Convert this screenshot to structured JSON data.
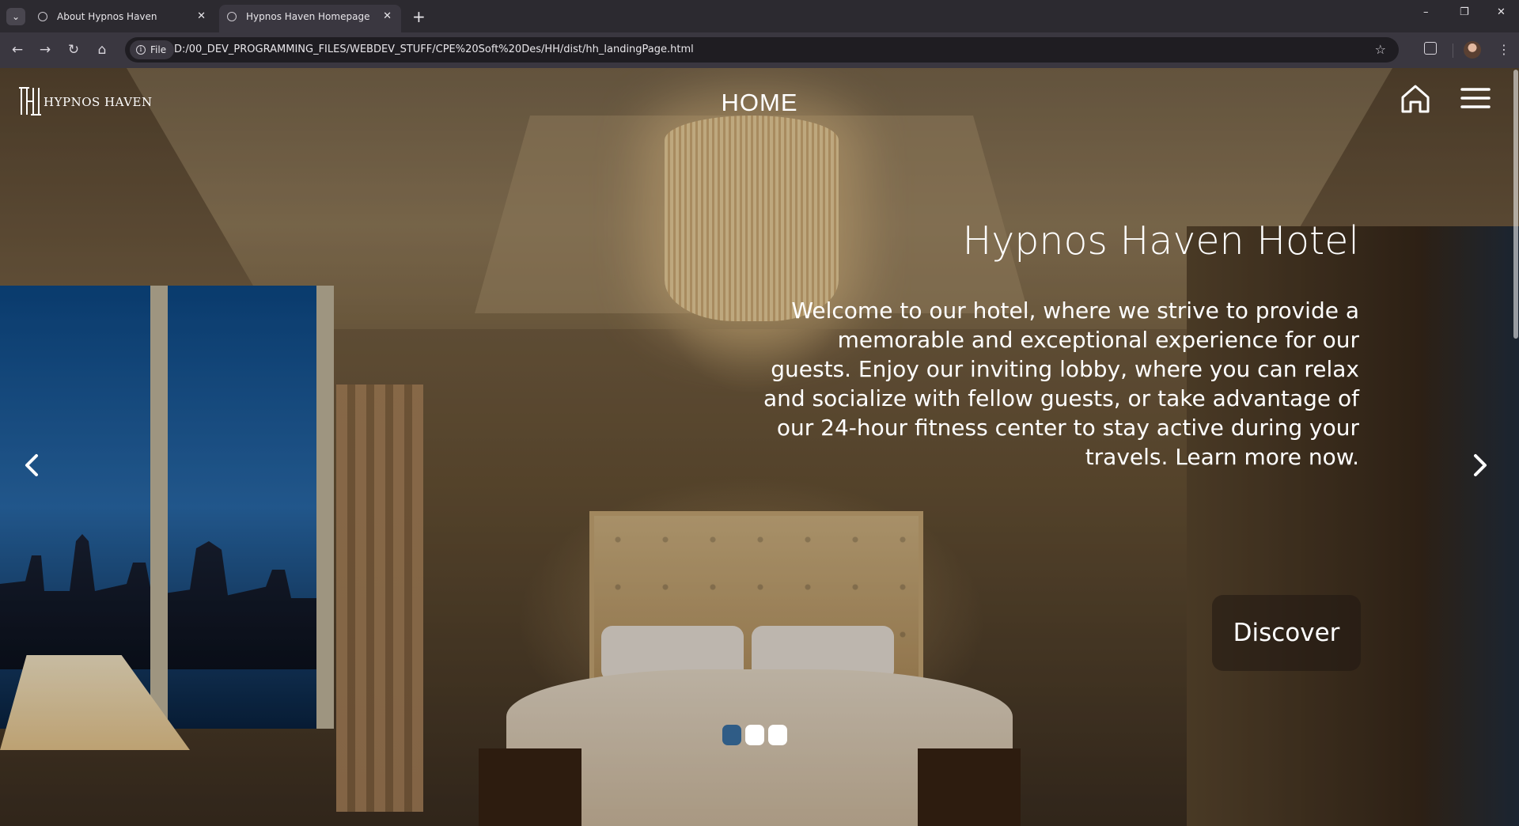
{
  "browser": {
    "tabs": [
      {
        "title": "About Hypnos Haven",
        "active": false
      },
      {
        "title": "Hypnos Haven Homepage",
        "active": true
      }
    ],
    "new_tab": "+",
    "close_glyph": "✕",
    "url_chip": "File",
    "url": "D:/00_DEV_PROGRAMMING_FILES/WEBDEV_STUFF/CPE%20Soft%20Des/HH/dist/hh_landingPage.html",
    "window_controls": {
      "minimize": "–",
      "restore": "❐",
      "close": "✕"
    }
  },
  "site": {
    "logo_text": "HYPNOS HAVEN",
    "page_heading": "HOME",
    "icons": [
      "home-icon",
      "hamburger-menu-icon",
      "chevron-left-icon",
      "chevron-right-icon"
    ]
  },
  "hero": {
    "title": "Hypnos Haven Hotel",
    "body": "Welcome to our hotel, where we strive to provide a memorable and exceptional experience for our guests. Enjoy our inviting lobby, where you can relax and socialize with fellow guests, or take advantage of our 24-hour fitness center to stay active during your travels. Learn more now.",
    "cta_label": "Discover"
  },
  "carousel": {
    "slide_count": 3,
    "active_index": 0
  },
  "colors": {
    "accent_dot": "#2f5c86",
    "text": "#ffffff",
    "chrome_dark": "#2c2a30"
  }
}
